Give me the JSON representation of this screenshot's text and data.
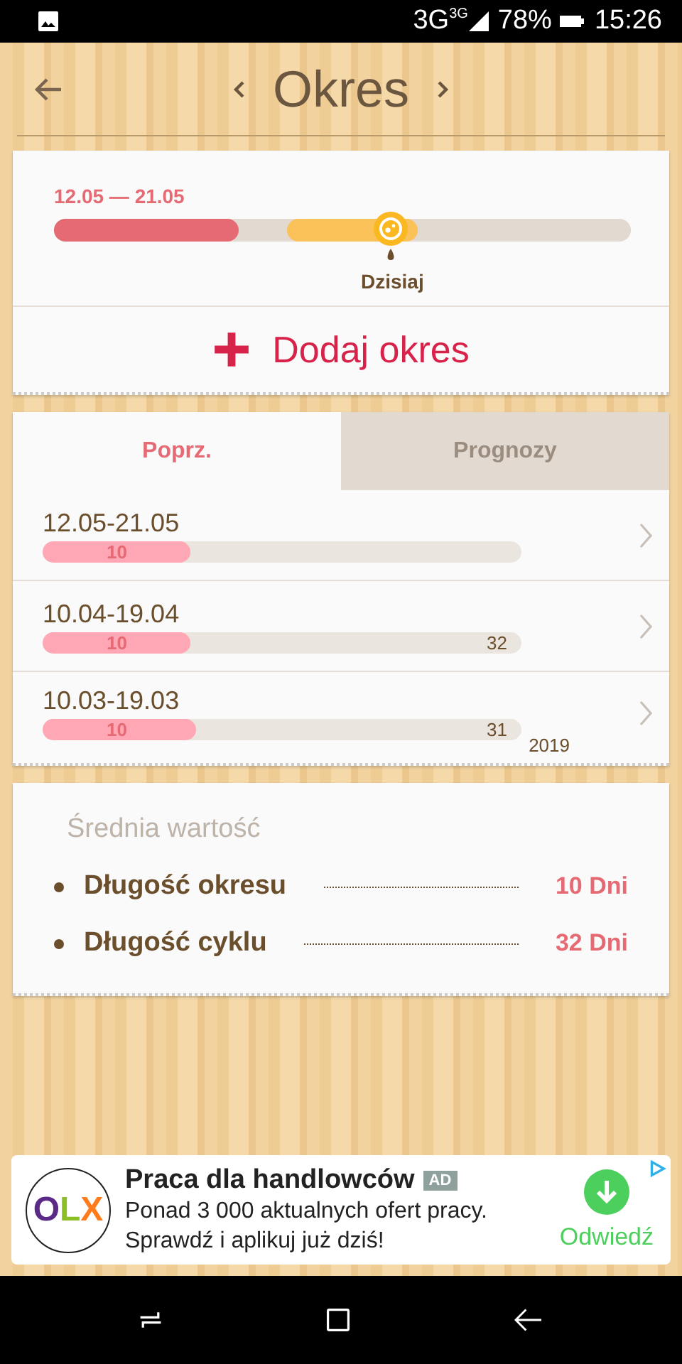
{
  "status_bar": {
    "network": "3G",
    "network_sup": "3G",
    "battery": "78%",
    "time": "15:26"
  },
  "header": {
    "title": "Okres"
  },
  "current": {
    "range": "12.05 — 21.05",
    "level": 0.32,
    "today_label": "Dzisiaj",
    "add_button": "Dodaj okres"
  },
  "tabs": [
    {
      "label": "Poprz.",
      "selected": true
    },
    {
      "label": "Prognozy",
      "selected": false
    }
  ],
  "periods": [
    {
      "dates": "12.05-21.05",
      "days": "10",
      "level": 0.31
    },
    {
      "dates": "10.04-19.04",
      "days": "10",
      "level": 0.31,
      "cycle": "32"
    },
    {
      "dates": "10.03-19.03",
      "days": "10",
      "level": 0.32,
      "cycle": "31"
    }
  ],
  "year": "2019",
  "averages": {
    "title": "Średnia wartość",
    "items": [
      {
        "label": "Długość okresu",
        "value": "10 Dni"
      },
      {
        "label": "Długość cyklu",
        "value": "32 Dni"
      }
    ]
  },
  "ad": {
    "logo": "OLX",
    "title": "Praca dla handlowców",
    "badge": "AD",
    "text": "Ponad 3 000 aktualnych ofert pracy. Sprawdź i aplikuj już dziś!",
    "action": "Odwiedź"
  }
}
